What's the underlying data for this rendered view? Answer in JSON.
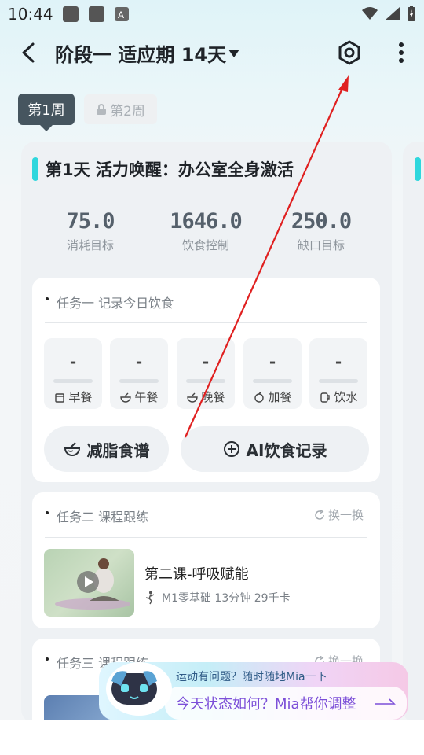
{
  "status_bar": {
    "time": "10:44"
  },
  "header": {
    "title": "阶段一 适应期 14天"
  },
  "weeks": {
    "week1": "第1周",
    "week2": "第2周"
  },
  "day": {
    "title": "第1天 活力唤醒：办公室全身激活",
    "stats": [
      {
        "value": "75.0",
        "label": "消耗目标"
      },
      {
        "value": "1646.0",
        "label": "饮食控制"
      },
      {
        "value": "250.0",
        "label": "缺口目标"
      }
    ]
  },
  "task1": {
    "title": "任务一 记录今日饮食",
    "meals": [
      {
        "value": "-",
        "label": "早餐",
        "icon": "breakfast-icon"
      },
      {
        "value": "-",
        "label": "午餐",
        "icon": "lunch-icon"
      },
      {
        "value": "-",
        "label": "晚餐",
        "icon": "dinner-icon"
      },
      {
        "value": "-",
        "label": "加餐",
        "icon": "snack-icon"
      },
      {
        "value": "-",
        "label": "饮水",
        "icon": "water-icon"
      }
    ],
    "recipe_button": "减脂食谱",
    "ai_button": "AI饮食记录"
  },
  "task2": {
    "title": "任务二 课程跟练",
    "refresh": "换一换",
    "course": {
      "title": "第二课-呼吸赋能",
      "meta": "M1零基础 13分钟 29千卡"
    }
  },
  "task3": {
    "title": "任务三 课程跟练",
    "refresh": "换一换"
  },
  "mia": {
    "subtitle": "运动有问题？随时随地Mia一下",
    "prompt": "今天状态如何？Mia帮你调整"
  },
  "colors": {
    "accent": "#2fd7dd",
    "tab_active": "#46555f",
    "mia_text": "#7c4fd8",
    "annotation_arrow": "#e02020"
  }
}
